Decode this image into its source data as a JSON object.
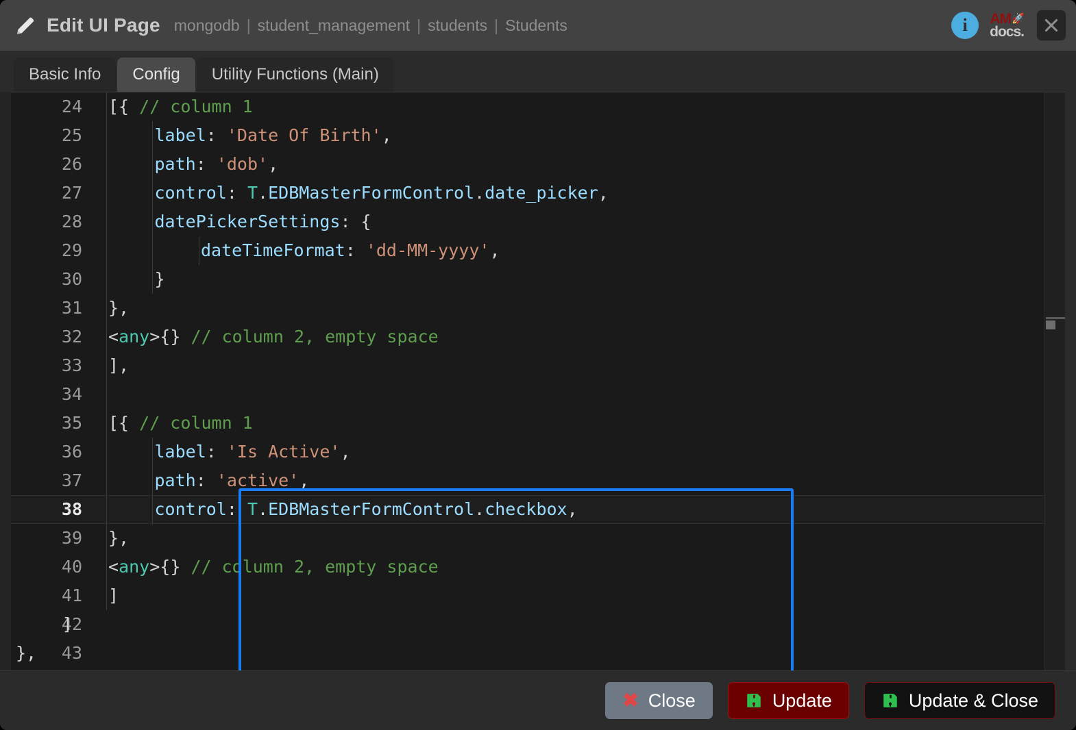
{
  "header": {
    "icon": "pencil-icon",
    "title": "Edit UI Page",
    "breadcrumb": [
      "mongodb",
      "student_management",
      "students",
      "Students"
    ],
    "breadcrumb_separator": "|",
    "info_icon": "info-icon",
    "info_glyph": "i",
    "brand_top": "AM",
    "brand_rocket": "🚀",
    "brand_bottom": "docs.",
    "close_icon": "close-icon"
  },
  "tabs": [
    {
      "label": "Basic Info",
      "active": false
    },
    {
      "label": "Config",
      "active": true
    },
    {
      "label": "Utility Functions (Main)",
      "active": false
    }
  ],
  "editor": {
    "active_line": 38,
    "first_line": 24,
    "last_line": 43,
    "lines": [
      {
        "no": "24",
        "guides": [
          0
        ],
        "tokens": [
          {
            "t": "pun",
            "v": "[{ "
          },
          {
            "t": "com",
            "v": "// column 1"
          }
        ],
        "indent": 0
      },
      {
        "no": "25",
        "guides": [
          0,
          1
        ],
        "tokens": [
          {
            "t": "key",
            "v": "label"
          },
          {
            "t": "pun",
            "v": ": "
          },
          {
            "t": "str",
            "v": "'Date Of Birth'"
          },
          {
            "t": "pun",
            "v": ","
          }
        ],
        "indent": 1
      },
      {
        "no": "26",
        "guides": [
          0,
          1
        ],
        "tokens": [
          {
            "t": "key",
            "v": "path"
          },
          {
            "t": "pun",
            "v": ": "
          },
          {
            "t": "str",
            "v": "'dob'"
          },
          {
            "t": "pun",
            "v": ","
          }
        ],
        "indent": 1
      },
      {
        "no": "27",
        "guides": [
          0,
          1
        ],
        "tokens": [
          {
            "t": "key",
            "v": "control"
          },
          {
            "t": "pun",
            "v": ": "
          },
          {
            "t": "type",
            "v": "T"
          },
          {
            "t": "pun",
            "v": "."
          },
          {
            "t": "id",
            "v": "EDBMasterFormControl"
          },
          {
            "t": "pun",
            "v": "."
          },
          {
            "t": "id",
            "v": "date_picker"
          },
          {
            "t": "pun",
            "v": ","
          }
        ],
        "indent": 1
      },
      {
        "no": "28",
        "guides": [
          0,
          1
        ],
        "tokens": [
          {
            "t": "key",
            "v": "datePickerSettings"
          },
          {
            "t": "pun",
            "v": ": {"
          }
        ],
        "indent": 1
      },
      {
        "no": "29",
        "guides": [
          0,
          1,
          2
        ],
        "tokens": [
          {
            "t": "key",
            "v": "dateTimeFormat"
          },
          {
            "t": "pun",
            "v": ": "
          },
          {
            "t": "str",
            "v": "'dd-MM-yyyy'"
          },
          {
            "t": "pun",
            "v": ","
          }
        ],
        "indent": 2
      },
      {
        "no": "30",
        "guides": [
          0,
          1
        ],
        "tokens": [
          {
            "t": "pun",
            "v": "}"
          }
        ],
        "indent": 1
      },
      {
        "no": "31",
        "guides": [
          0
        ],
        "tokens": [
          {
            "t": "pun",
            "v": "},"
          }
        ],
        "indent": 0
      },
      {
        "no": "32",
        "guides": [
          0
        ],
        "tokens": [
          {
            "t": "pun",
            "v": "<"
          },
          {
            "t": "type",
            "v": "any"
          },
          {
            "t": "pun",
            "v": ">{} "
          },
          {
            "t": "com",
            "v": "// column 2, empty space"
          }
        ],
        "indent": 0
      },
      {
        "no": "33",
        "guides": [
          0
        ],
        "tokens": [
          {
            "t": "pun",
            "v": "],"
          }
        ],
        "indent": 0
      },
      {
        "no": "34",
        "guides": [
          0
        ],
        "tokens": [],
        "indent": 0
      },
      {
        "no": "35",
        "guides": [
          0
        ],
        "tokens": [
          {
            "t": "pun",
            "v": "[{ "
          },
          {
            "t": "com",
            "v": "// column 1"
          }
        ],
        "indent": 0
      },
      {
        "no": "36",
        "guides": [
          0,
          1
        ],
        "tokens": [
          {
            "t": "key",
            "v": "label"
          },
          {
            "t": "pun",
            "v": ": "
          },
          {
            "t": "str",
            "v": "'Is Active'"
          },
          {
            "t": "pun",
            "v": ","
          }
        ],
        "indent": 1
      },
      {
        "no": "37",
        "guides": [
          0,
          1
        ],
        "tokens": [
          {
            "t": "key",
            "v": "path"
          },
          {
            "t": "pun",
            "v": ": "
          },
          {
            "t": "str",
            "v": "'active'"
          },
          {
            "t": "pun",
            "v": ","
          }
        ],
        "indent": 1
      },
      {
        "no": "38",
        "guides": [
          0,
          1
        ],
        "tokens": [
          {
            "t": "key",
            "v": "control"
          },
          {
            "t": "pun",
            "v": ": "
          },
          {
            "t": "type",
            "v": "T"
          },
          {
            "t": "pun",
            "v": "."
          },
          {
            "t": "id",
            "v": "EDBMasterFormControl"
          },
          {
            "t": "pun",
            "v": "."
          },
          {
            "t": "id",
            "v": "checkbox"
          },
          {
            "t": "pun",
            "v": ","
          }
        ],
        "indent": 1
      },
      {
        "no": "39",
        "guides": [
          0
        ],
        "tokens": [
          {
            "t": "pun",
            "v": "},"
          }
        ],
        "indent": 0
      },
      {
        "no": "40",
        "guides": [
          0
        ],
        "tokens": [
          {
            "t": "pun",
            "v": "<"
          },
          {
            "t": "type",
            "v": "any"
          },
          {
            "t": "pun",
            "v": ">{} "
          },
          {
            "t": "com",
            "v": "// column 2, empty space"
          }
        ],
        "indent": 0
      },
      {
        "no": "41",
        "guides": [
          0
        ],
        "tokens": [
          {
            "t": "pun",
            "v": "]"
          }
        ],
        "indent": 0
      },
      {
        "no": "42",
        "guides": [],
        "tokens": [
          {
            "t": "pun",
            "v": "]"
          }
        ],
        "indent": -1
      },
      {
        "no": "43",
        "guides": [],
        "tokens": [
          {
            "t": "pun",
            "v": "},"
          }
        ],
        "indent": -2
      }
    ],
    "highlight_box": {
      "color": "#1a7cf5"
    },
    "syntax_colors": {
      "key": "#9cdcfe",
      "string": "#ce9178",
      "comment": "#5f9e4e",
      "type": "#4ec9b0",
      "punctuation": "#d4d4d4",
      "background": "#1a1a1a",
      "line_number": "#9a9a9a"
    }
  },
  "footer": {
    "buttons": [
      {
        "label": "Close",
        "icon": "x-icon",
        "style": "close"
      },
      {
        "label": "Update",
        "icon": "save-icon",
        "style": "update"
      },
      {
        "label": "Update & Close",
        "icon": "save-icon",
        "style": "update-close"
      }
    ]
  }
}
